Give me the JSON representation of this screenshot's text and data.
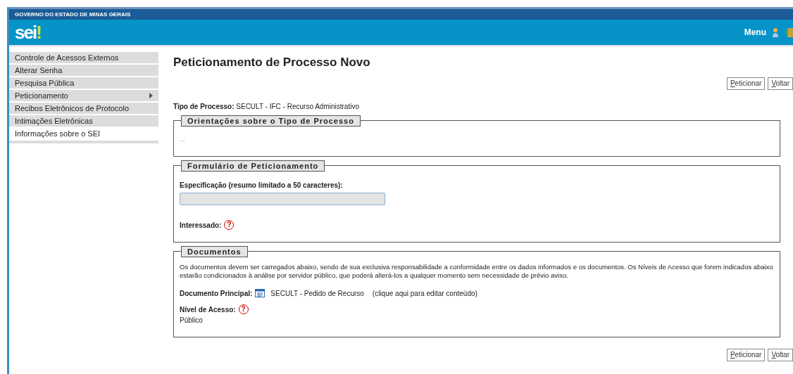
{
  "header": {
    "government": "GOVERNO DO ESTADO DE MINAS GERAIS",
    "logo": "sei",
    "logo_mark": "!",
    "menu": "Menu"
  },
  "sidebar": {
    "items": [
      {
        "label": "Controle de Acessos Externos",
        "selected": false,
        "submenu": false
      },
      {
        "label": "Alterar Senha",
        "selected": false,
        "submenu": false
      },
      {
        "label": "Pesquisa Pública",
        "selected": false,
        "submenu": false
      },
      {
        "label": "Peticionamento",
        "selected": false,
        "submenu": true
      },
      {
        "label": "Recibos Eletrônicos de Protocolo",
        "selected": false,
        "submenu": false
      },
      {
        "label": "Intimações Eletrônicas",
        "selected": false,
        "submenu": false
      },
      {
        "label": "Informações sobre o SEI",
        "selected": true,
        "submenu": false
      }
    ]
  },
  "page": {
    "title": "Peticionamento de Processo Novo",
    "buttons_top": [
      {
        "key": "P",
        "rest": "eticionar"
      },
      {
        "key": "V",
        "rest": "oltar"
      }
    ],
    "tipo_label": "Tipo de Processo:",
    "tipo_value": "SECULT - IFC - Recurso Administrativo",
    "orientacoes": {
      "legend": "Orientações sobre o Tipo de Processo",
      "text": "..."
    },
    "formulario": {
      "legend": "Formulário de Peticionamento",
      "spec_label": "Especificação (resumo limitado a 50 caracteres):",
      "interessado_label": "Interessado:",
      "help": "?"
    },
    "documentos": {
      "legend": "Documentos",
      "text": "Os documentos devem ser carregados abaixo, sendo de sua exclusiva responsabilidade a conformidade entre os dados informados e os documentos. Os Níveis de Acesso que forem indicados abaixo estarão condicionados à análise por servidor público, que poderá alterá-los a qualquer momento sem necessidade de prévio aviso.",
      "principal_label": "Documento Principal:",
      "principal_value": "SECULT - Pedido de Recurso",
      "principal_link": "(clique aqui para editar conteúdo)",
      "nivel_label": "Nível de Acesso:",
      "help": "?",
      "nivel_value": "Público"
    },
    "buttons_bottom": [
      {
        "key": "P",
        "rest": "eticionar"
      },
      {
        "key": "V",
        "rest": "oltar"
      }
    ]
  }
}
